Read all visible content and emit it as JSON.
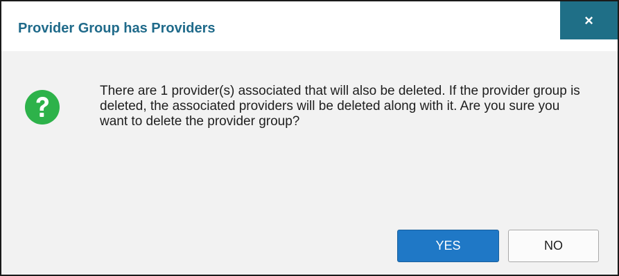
{
  "dialog": {
    "title": "Provider Group has Providers",
    "close_label": "×",
    "icon": "question-circle-icon",
    "message": "There are 1 provider(s) associated that will also be deleted. If the provider group is deleted, the associated providers will be deleted along with it. Are you sure you want to delete the provider group?",
    "buttons": {
      "yes": "YES",
      "no": "NO"
    }
  },
  "colors": {
    "title_text": "#1f6a8a",
    "close_button_bg": "#1f6f87",
    "icon_green": "#2db24a",
    "yes_button_bg": "#1f78c6"
  }
}
